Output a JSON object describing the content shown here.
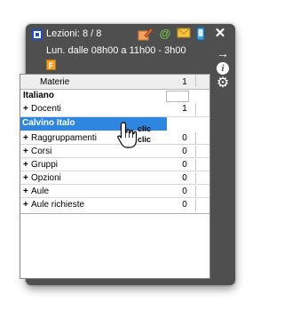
{
  "header": {
    "title": "Lezioni: 8 / 8",
    "time": "Lun. dalle 08h00 a 11h00 - 3h00",
    "badge": "F",
    "icons": [
      "lesson-icon",
      "edit-icon",
      "at-icon",
      "mail-icon",
      "phone-icon",
      "close-icon"
    ],
    "at_symbol": "@",
    "close_symbol": "✕"
  },
  "side_buttons": {
    "arrow": "→",
    "info": "i",
    "gear": "⚙"
  },
  "table": {
    "header": {
      "label": "Materie",
      "count": "1"
    },
    "subject": "Italiano",
    "docenti": {
      "label": "Docenti",
      "count": "1"
    },
    "selected_teacher": "Calvino Italo",
    "groups": [
      {
        "label": "Raggruppamenti",
        "count": "0"
      },
      {
        "label": "Corsi",
        "count": "0"
      },
      {
        "label": "Gruppi",
        "count": "0"
      },
      {
        "label": "Opzioni",
        "count": "0"
      },
      {
        "label": "Aule",
        "count": "0"
      },
      {
        "label": "Aule richieste",
        "count": "0"
      }
    ]
  },
  "cursor_hint": {
    "line1": "clic",
    "line2": "clic"
  },
  "colors": {
    "window_bg": "#4f4f4f",
    "selection": "#2f86e0",
    "badge": "#f0a020",
    "at_icon": "#6fc24a",
    "lesson_icon": "#1e4fc8"
  }
}
